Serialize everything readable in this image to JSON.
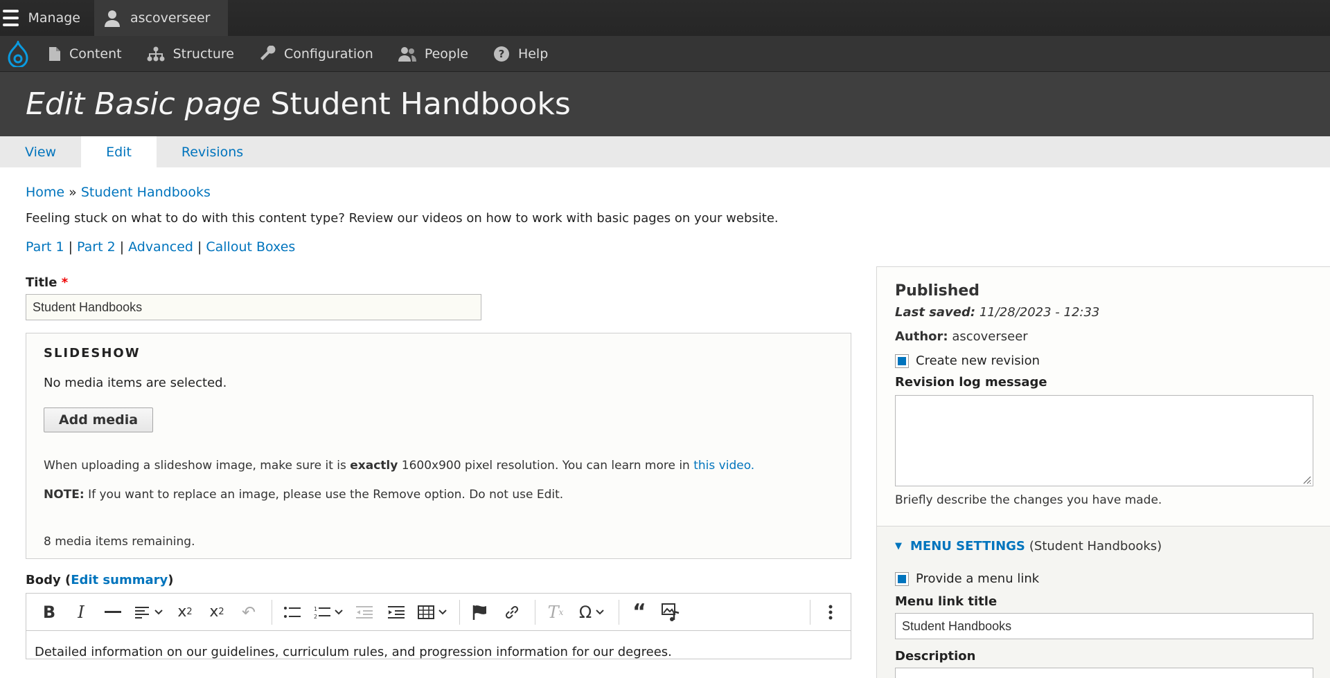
{
  "toolbar": {
    "manage": "Manage",
    "user": "ascoverseer"
  },
  "tray": {
    "items": [
      "Content",
      "Structure",
      "Configuration",
      "People",
      "Help"
    ]
  },
  "header": {
    "title_prefix": "Edit Basic page",
    "title_name": " Student Handbooks"
  },
  "tabs": [
    "View",
    "Edit",
    "Revisions"
  ],
  "breadcrumb": {
    "home": "Home",
    "sep": " » ",
    "current": "Student Handbooks"
  },
  "help_text": "Feeling stuck on what to do with this content type? Review our videos on how to work with basic pages on your website.",
  "help_links": [
    "Part 1",
    "Part 2",
    "Advanced",
    "Callout Boxes"
  ],
  "link_sep": "|",
  "title_field": {
    "label": "Title",
    "required": "*",
    "value": "Student Handbooks"
  },
  "slideshow": {
    "legend": "SLIDESHOW",
    "empty": "No media items are selected.",
    "add_button": "Add media",
    "hint_before": "When uploading a slideshow image, make sure it is ",
    "hint_bold": "exactly",
    "hint_after": " 1600x900 pixel resolution. You can learn more in ",
    "hint_link": "this video.",
    "note_label": "NOTE:",
    "note_text": " If you want to replace an image, please use the Remove option. Do not use Edit.",
    "remaining": "8 media items remaining."
  },
  "body_field": {
    "label": "Body (",
    "summary_link": "Edit summary",
    "label_close": ")",
    "content": "Detailed information on our guidelines, curriculum rules, and progression information for our degrees."
  },
  "sidebar": {
    "status": "Published",
    "last_saved_label": "Last saved:",
    "last_saved_value": " 11/28/2023 - 12:33",
    "author_label": "Author:",
    "author_value": " ascoverseer",
    "new_revision": "Create new revision",
    "revision_label": "Revision log message",
    "revision_desc": "Briefly describe the changes you have made.",
    "menu_title": "MENU SETTINGS",
    "menu_sub": "(Student Handbooks)",
    "provide_link": "Provide a menu link",
    "link_title_label": "Menu link title",
    "link_title_value": "Student Handbooks",
    "description_label": "Description"
  }
}
